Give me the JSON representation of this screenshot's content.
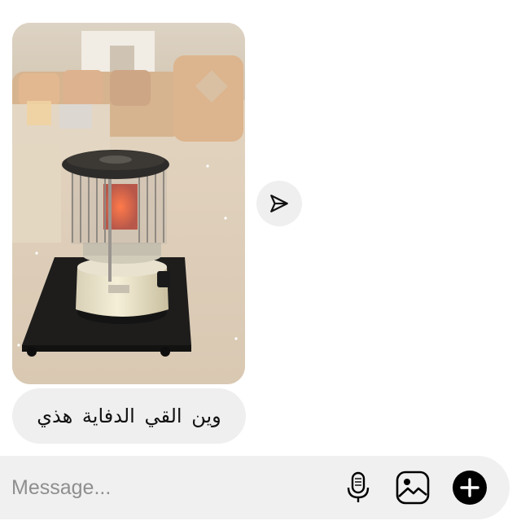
{
  "conversation": {
    "photo_message": {
      "icon": "photo",
      "description_icon": "kerosene-heater-photo"
    },
    "share_button": {
      "icon": "paper-plane-icon"
    },
    "text_message": {
      "text": "وين القي الدفاية  هذي"
    }
  },
  "composer": {
    "placeholder": "Message...",
    "value": "",
    "mic_icon": "microphone-icon",
    "gallery_icon": "image-gallery-icon",
    "add_icon": "plus-circle-icon"
  },
  "colors": {
    "bubble_bg": "#efefef",
    "composer_bg": "#f0f0f0",
    "text": "#111111",
    "placeholder": "#8e8e8e",
    "icon": "#000000"
  }
}
